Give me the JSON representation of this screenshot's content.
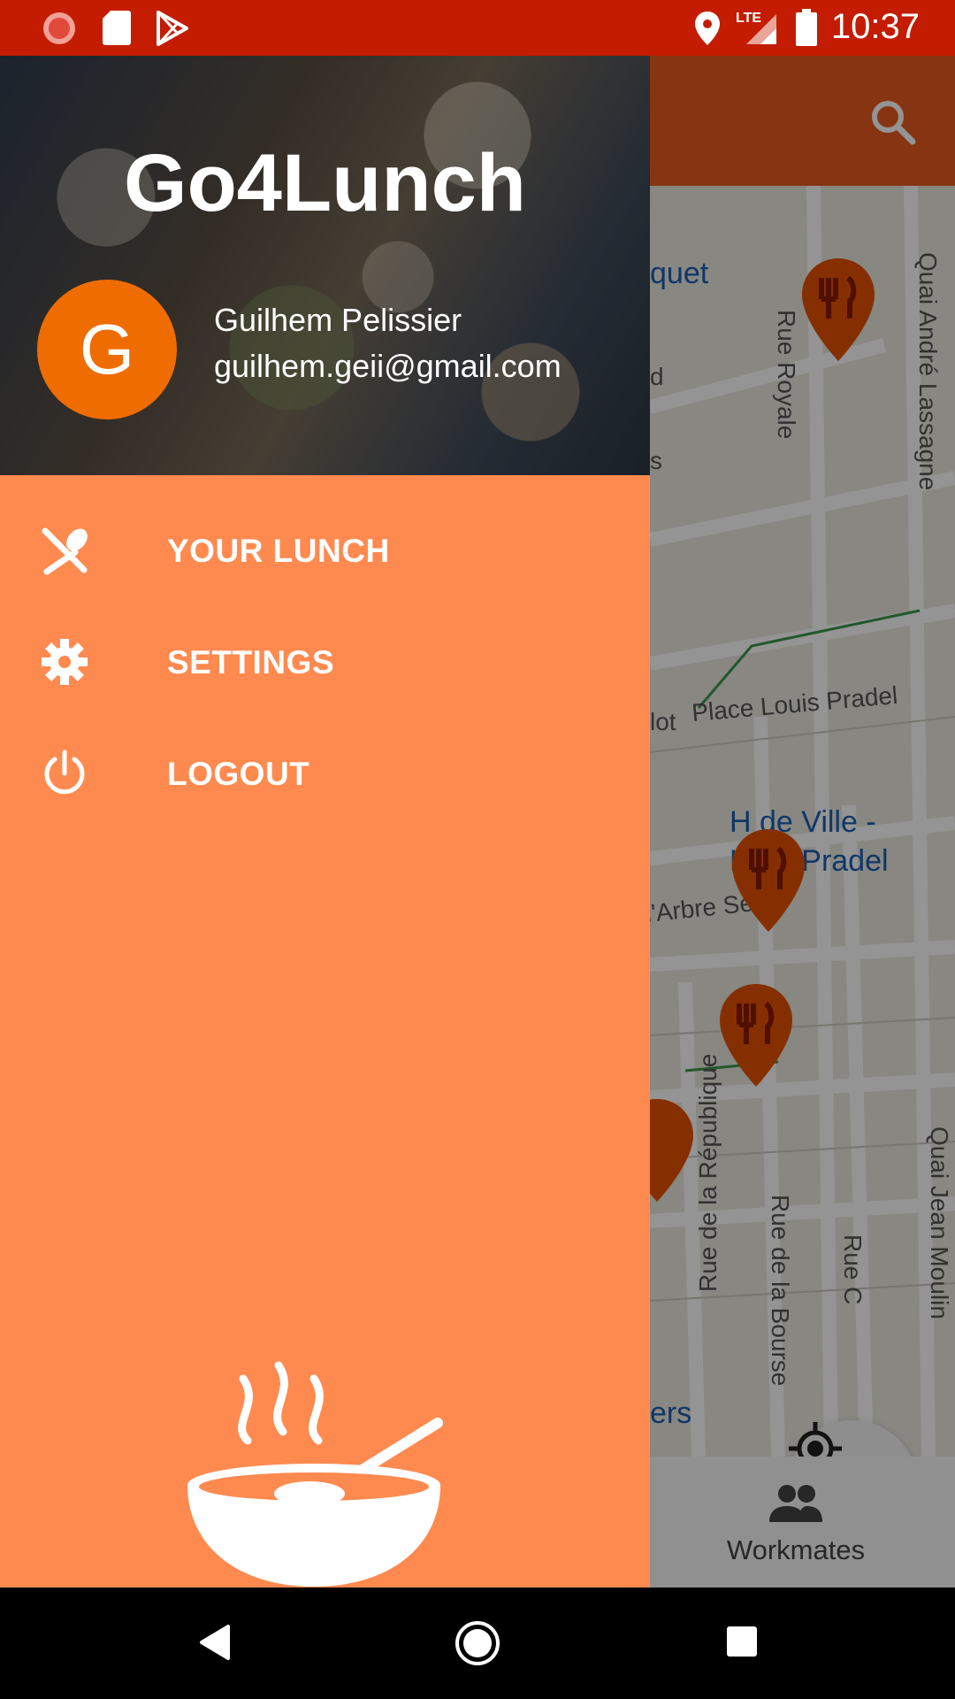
{
  "status_bar": {
    "time": "10:37",
    "network": "LTE"
  },
  "drawer": {
    "app_title": "Go4Lunch",
    "user": {
      "avatar_letter": "G",
      "name": "Guilhem Pelissier",
      "email": "guilhem.geii@gmail.com"
    },
    "menu": [
      {
        "label": "YOUR LUNCH",
        "icon": "fork-spoon-icon"
      },
      {
        "label": "SETTINGS",
        "icon": "gear-icon"
      },
      {
        "label": "LOGOUT",
        "icon": "power-icon"
      }
    ]
  },
  "map": {
    "labels": {
      "quet": "quet",
      "rue_royale": "Rue Royale",
      "quai_andre": "Quai André Lassagne",
      "d": "d",
      "s": "s",
      "lot": "lot",
      "place_louis_pradel": "Place Louis Pradel",
      "hotel_de_ville_1": "H     de Ville -",
      "hotel_de_ville_2": "Lo    is Pradel",
      "arbre_sec": "l'Arbre Sec",
      "rue_republique": "Rue de la République",
      "rue_bourse": "Rue de la Bourse",
      "rue_c": "Rue C",
      "quai_jean": "Quai Jean Moulin",
      "ers": "ers"
    }
  },
  "bottom_nav": {
    "workmates_label": "Workmates"
  },
  "colors": {
    "status_bar": "#c41c00",
    "drawer": "#ff8a50",
    "avatar": "#ef6c00",
    "toolbar": "#e85a1f",
    "marker": "#e65100"
  }
}
